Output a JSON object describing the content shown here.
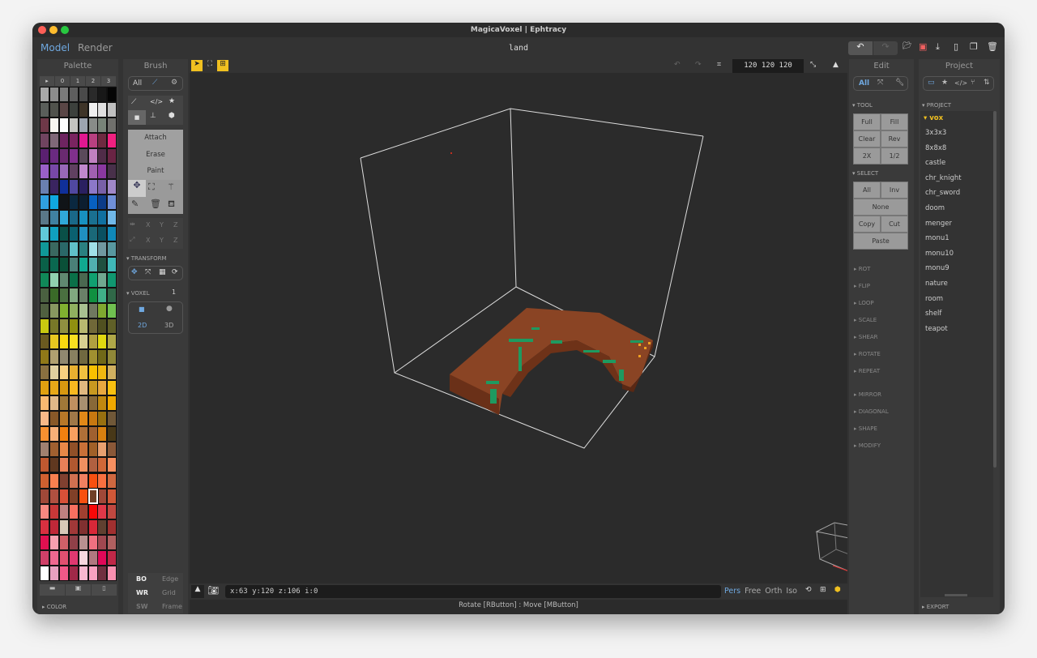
{
  "window": {
    "title": "MagicaVoxel | Ephtracy"
  },
  "menu": {
    "model": "Model",
    "render": "Render",
    "file_name": "land"
  },
  "palette": {
    "title": "Palette",
    "tabs": [
      "▸",
      "0",
      "1",
      "2",
      "3"
    ],
    "color_section": "COLOR",
    "selected": [
      26,
      5
    ],
    "colors": [
      [
        "#a8a8a8",
        "#8c8c8c",
        "#7a7a7a",
        "#5e5e5e",
        "#4a4a4a",
        "#2a2a2a",
        "#181818",
        "#050505"
      ],
      [
        "#5a5e5a",
        "#50524c",
        "#5a4646",
        "#3c403c",
        "#3e3428",
        "#f0f0f0",
        "#e0e0e0",
        "#c0c0c0"
      ],
      [
        "#6e3848",
        "#f8f6f0",
        "#ffffff",
        "#c4c4c0",
        "#9ca4b0",
        "#888c88",
        "#788478",
        "#70706c"
      ],
      [
        "#704460",
        "#806878",
        "#6e2460",
        "#7a2460",
        "#e01890",
        "#b84080",
        "#6e2a40",
        "#f02080"
      ],
      [
        "#5a2070",
        "#6a2a80",
        "#6a2a70",
        "#80308c",
        "#5a4a5a",
        "#c080c0",
        "#502c48",
        "#6a2444"
      ],
      [
        "#9a60c8",
        "#7848a8",
        "#9868b8",
        "#604060",
        "#c088cc",
        "#a060b0",
        "#8a38a0",
        "#48304a"
      ],
      [
        "#6a80b0",
        "#3a2460",
        "#10309a",
        "#5048a0",
        "#2a2060",
        "#8c78c8",
        "#7860a8",
        "#a088c8"
      ],
      [
        "#30a0e0",
        "#10a8e0",
        "#101418",
        "#0a2840",
        "#0c1e30",
        "#0860c0",
        "#0c3c88",
        "#7090d8"
      ],
      [
        "#5a7888",
        "#4080a0",
        "#30a8d8",
        "#1a6888",
        "#1890c0",
        "#1a7090",
        "#1070a0",
        "#70b8e8"
      ],
      [
        "#60c8d8",
        "#10a0c0",
        "#0a5048",
        "#0a6070",
        "#2090c0",
        "#1a6878",
        "#0a5060",
        "#1088b8"
      ],
      [
        "#109898",
        "#3a6860",
        "#2a6868",
        "#60c0c8",
        "#2a8080",
        "#a0e0e8",
        "#7098a0",
        "#5898a0"
      ],
      [
        "#0a6048",
        "#0a6850",
        "#0a5038",
        "#4a8078",
        "#10a890",
        "#50b0b0",
        "#205040",
        "#40b8b8"
      ],
      [
        "#108858",
        "#90d0b0",
        "#608870",
        "#0a7048",
        "#4a6850",
        "#10a070",
        "#70a890",
        "#109870"
      ],
      [
        "#4a6040",
        "#3a6a28",
        "#4a7040",
        "#80a880",
        "#6a8068",
        "#109040",
        "#40b088",
        "#306848"
      ],
      [
        "#506040",
        "#889860",
        "#80b030",
        "#90b060",
        "#a8c090",
        "#707860",
        "#80a830",
        "#70c050"
      ],
      [
        "#c8c810",
        "#787828",
        "#909040",
        "#909010",
        "#b8b870",
        "#706838",
        "#505020",
        "#606028"
      ],
      [
        "#6a5a20",
        "#e8c820",
        "#f8d810",
        "#f8e020",
        "#d8d090",
        "#b0a040",
        "#e0d810",
        "#b0a848"
      ],
      [
        "#907818",
        "#b0a070",
        "#908870",
        "#888060",
        "#706840",
        "#a09030",
        "#706818",
        "#908838"
      ],
      [
        "#8a7040",
        "#e0d0a0",
        "#f8d080",
        "#e8b030",
        "#f0c040",
        "#f8c000",
        "#f0b810",
        "#d0b060"
      ],
      [
        "#e0a010",
        "#e8a818",
        "#d89810",
        "#f8b820",
        "#e0b880",
        "#c89820",
        "#e8a840",
        "#f8c010"
      ],
      [
        "#f8b870",
        "#e0b888",
        "#a07838",
        "#c09060",
        "#a89070",
        "#886838",
        "#c08810",
        "#f0a800"
      ],
      [
        "#f8b888",
        "#885828",
        "#b87828",
        "#a07848",
        "#e08818",
        "#c87810",
        "#987010",
        "#705838"
      ],
      [
        "#f89030",
        "#f8b078",
        "#f08010",
        "#f8a060",
        "#b07038",
        "#a06030",
        "#d88010",
        "#483818"
      ],
      [
        "#a08070",
        "#a06030",
        "#e88848",
        "#905028",
        "#c87038",
        "#a06028",
        "#e8a070",
        "#8a5838"
      ],
      [
        "#c05830",
        "#603820",
        "#e88058",
        "#b05830",
        "#f09060",
        "#b06040",
        "#d06838",
        "#f89060"
      ],
      [
        "#d06030",
        "#f88050",
        "#804030",
        "#d07050",
        "#f08060",
        "#f85010",
        "#f87040",
        "#d06840"
      ],
      [
        "#a04838",
        "#b05040",
        "#d85038",
        "#804028",
        "#f85010",
        "#704028",
        "#a04838",
        "#d05838"
      ],
      [
        "#f88880",
        "#c83838",
        "#c08080",
        "#f87060",
        "#a04030",
        "#f80808",
        "#e03848",
        "#c04840"
      ],
      [
        "#d83040",
        "#c02838",
        "#d8c8b8",
        "#a03838",
        "#803030",
        "#d82838",
        "#604030",
        "#a03030"
      ],
      [
        "#e01050",
        "#f8a0b0",
        "#d06068",
        "#904048",
        "#b89090",
        "#f07080",
        "#a04850",
        "#b06060"
      ],
      [
        "#d04068",
        "#f06890",
        "#e05070",
        "#e03870",
        "#f8d8e0",
        "#b07880",
        "#e00858",
        "#c02848"
      ],
      [
        "#ffffff",
        "#e8a0c0",
        "#f05888",
        "#a02848",
        "#f8b8d0",
        "#f8a0c0",
        "#703040",
        "#f890b0"
      ]
    ]
  },
  "brush": {
    "title": "Brush",
    "all": "All",
    "modes": [
      "Attach",
      "Erase",
      "Paint"
    ],
    "axes": [
      "X",
      "Y",
      "Z"
    ],
    "transform": "TRANSFORM",
    "voxel": "VOXEL",
    "voxel_size": "1",
    "dim2": "2D",
    "dim3": "3D",
    "render_toggles": [
      [
        "BO",
        "Edge"
      ],
      [
        "WR",
        "Grid"
      ],
      [
        "SW",
        "Frame"
      ]
    ]
  },
  "viewport": {
    "size": "120  120  120",
    "coords": "x:63   y:120  z:106  i:0",
    "hint": "Rotate [RButton] : Move [MButton]",
    "views": [
      "Pers",
      "Free",
      "Orth",
      "Iso"
    ],
    "active_view": "Pers",
    "accent": "#f0c020"
  },
  "edit": {
    "title": "Edit",
    "all": "All",
    "tool": "TOOL",
    "tool_buttons": [
      [
        "Full",
        "Fill"
      ],
      [
        "Clear",
        "Rev"
      ],
      [
        "2X",
        "1/2"
      ]
    ],
    "select": "SELECT",
    "select_buttons": {
      "all": "All",
      "inv": "Inv",
      "none": "None",
      "copy": "Copy",
      "cut": "Cut",
      "paste": "Paste"
    },
    "sections": [
      "ROT",
      "FLIP",
      "LOOP",
      "SCALE",
      "SHEAR",
      "ROTATE",
      "REPEAT",
      "MIRROR",
      "DIAGONAL",
      "SHAPE",
      "MODIFY"
    ]
  },
  "project": {
    "title": "Project",
    "section": "PROJECT",
    "folder": "vox",
    "items": [
      "3x3x3",
      "8x8x8",
      "castle",
      "chr_knight",
      "chr_sword",
      "doom",
      "menger",
      "monu1",
      "monu10",
      "monu9",
      "nature",
      "room",
      "shelf",
      "teapot"
    ],
    "export": "EXPORT"
  }
}
